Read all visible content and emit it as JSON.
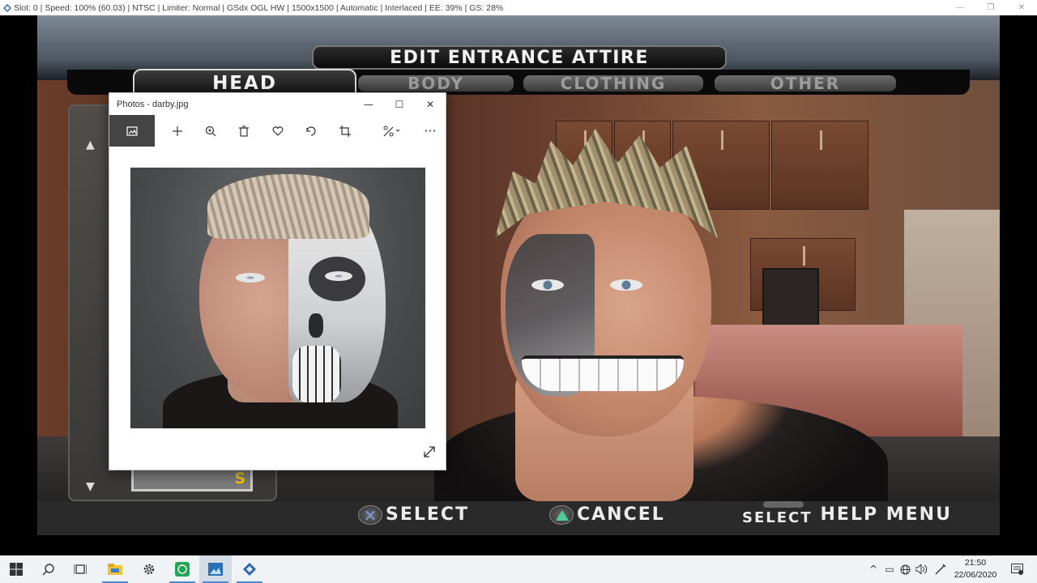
{
  "emulator": {
    "title": "Slot: 0 | Speed: 100% (60.03) | NTSC | Limiter: Normal | GSdx OGL HW | 1500x1500 | Automatic | Interlaced | EE:  39% | GS:  28%"
  },
  "game": {
    "menu_title": "EDIT ENTRANCE ATTIRE",
    "tabs": [
      {
        "label": "HEAD",
        "active": true
      },
      {
        "label": "BODY",
        "active": false
      },
      {
        "label": "CLOTHING",
        "active": false
      },
      {
        "label": "OTHER",
        "active": false
      }
    ],
    "swatch_letter": "S",
    "prompts": {
      "select": "SELECT",
      "cancel": "CANCEL",
      "select_button": "SELECT",
      "help_menu": "HELP MENU"
    }
  },
  "photos_window": {
    "title": "Photos - darby.jpg",
    "toolbar": [
      "image-icon",
      "add-icon",
      "zoom-icon",
      "delete-icon",
      "favorite-icon",
      "rotate-icon",
      "crop-icon",
      "edit-icon",
      "more-icon"
    ],
    "more_label": "···"
  },
  "taskbar": {
    "time": "21:50",
    "date": "22/06/2020"
  },
  "colors": {
    "taskbar": "#f0f3f5",
    "accent": "#4b8ad4",
    "swatch_letter": "#f1c40f"
  }
}
